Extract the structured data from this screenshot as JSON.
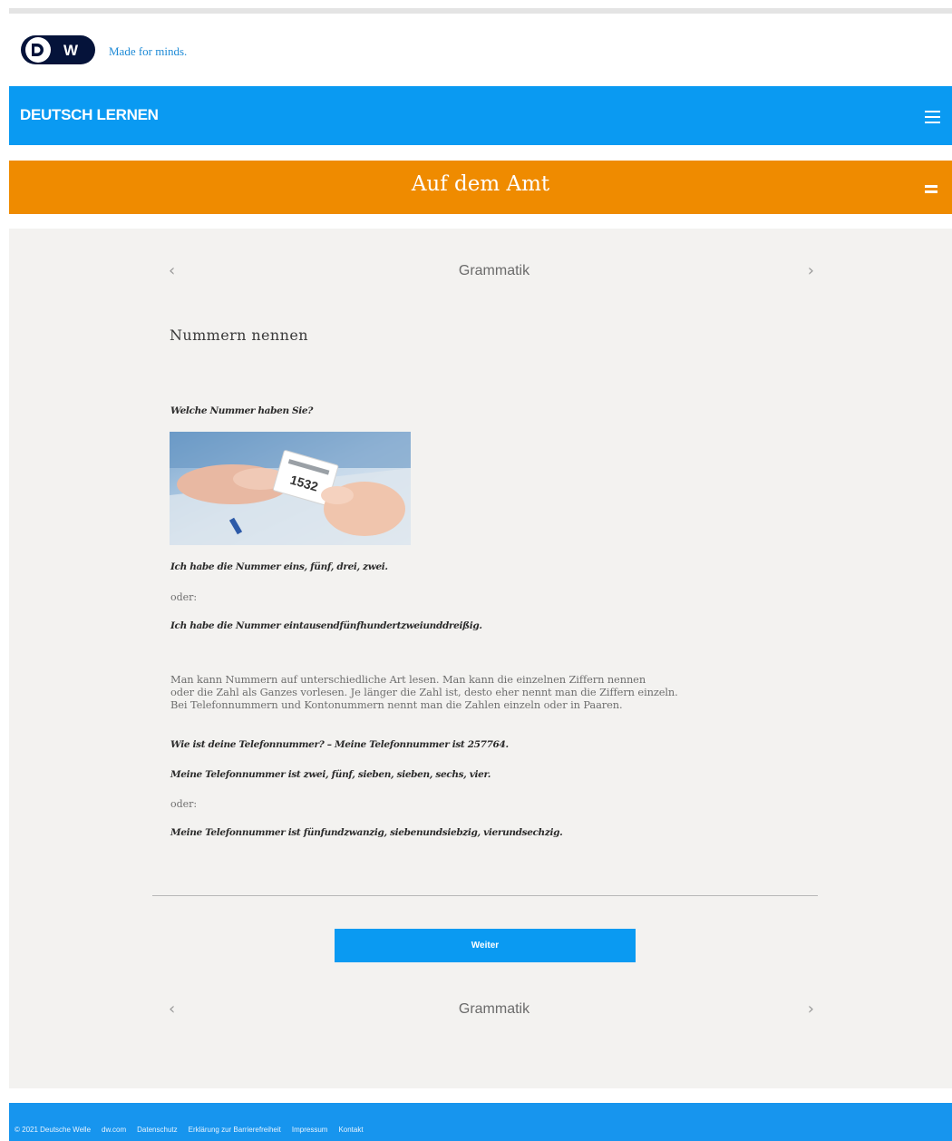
{
  "brand": {
    "logo_text": "DW",
    "tagline": "Made for minds."
  },
  "site": {
    "title": "DEUTSCH LERNEN",
    "menu_icon": "hamburger-menu-icon"
  },
  "lesson": {
    "title": "Auf dem Amt",
    "menu_icon": "equals-menu-icon"
  },
  "pager": {
    "label": "Grammatik",
    "prev_icon": "chevron-left-icon",
    "next_icon": "chevron-right-icon"
  },
  "article": {
    "title": "Nummern nennen",
    "question": "Welche Nummer haben Sie?",
    "photo_ticket_number": "1532",
    "answer1": "Ich habe die Nummer eins, fünf, drei, zwei.",
    "or1": "oder:",
    "answer2": "Ich habe die Nummer eintausendfünfhundertzweiunddreißig.",
    "paragraph_lines": [
      "Man kann Nummern auf unterschiedliche Art lesen. Man kann die einzelnen Ziffern nennen",
      "oder die Zahl als Ganzes vorlesen. Je länger die Zahl ist, desto eher nennt man die Ziffern einzeln.",
      "Bei Telefonnummern und Kontonummern nennt man die Zahlen einzeln oder in Paaren."
    ],
    "example1": "Wie ist deine Telefonnummer? – Meine Telefonnummer ist 257764.",
    "example2": "Meine Telefonnummer ist zwei, fünf, sieben, sieben, sechs, vier.",
    "or2": "oder:",
    "example3": "Meine Telefonnummer ist fünfundzwanzig, siebenundsiebzig, vierundsechzig."
  },
  "button": {
    "label": "Weiter"
  },
  "footer": {
    "links": [
      "© 2021 Deutsche Welle",
      "dw.com",
      "Datenschutz",
      "Erklärung zur Barrierefreiheit",
      "Impressum",
      "Kontakt"
    ]
  },
  "colors": {
    "site_blue": "#0a9af2",
    "lesson_orange": "#ef8b00",
    "content_bg": "#f3f2f0",
    "dw_navy": "#05133a"
  }
}
